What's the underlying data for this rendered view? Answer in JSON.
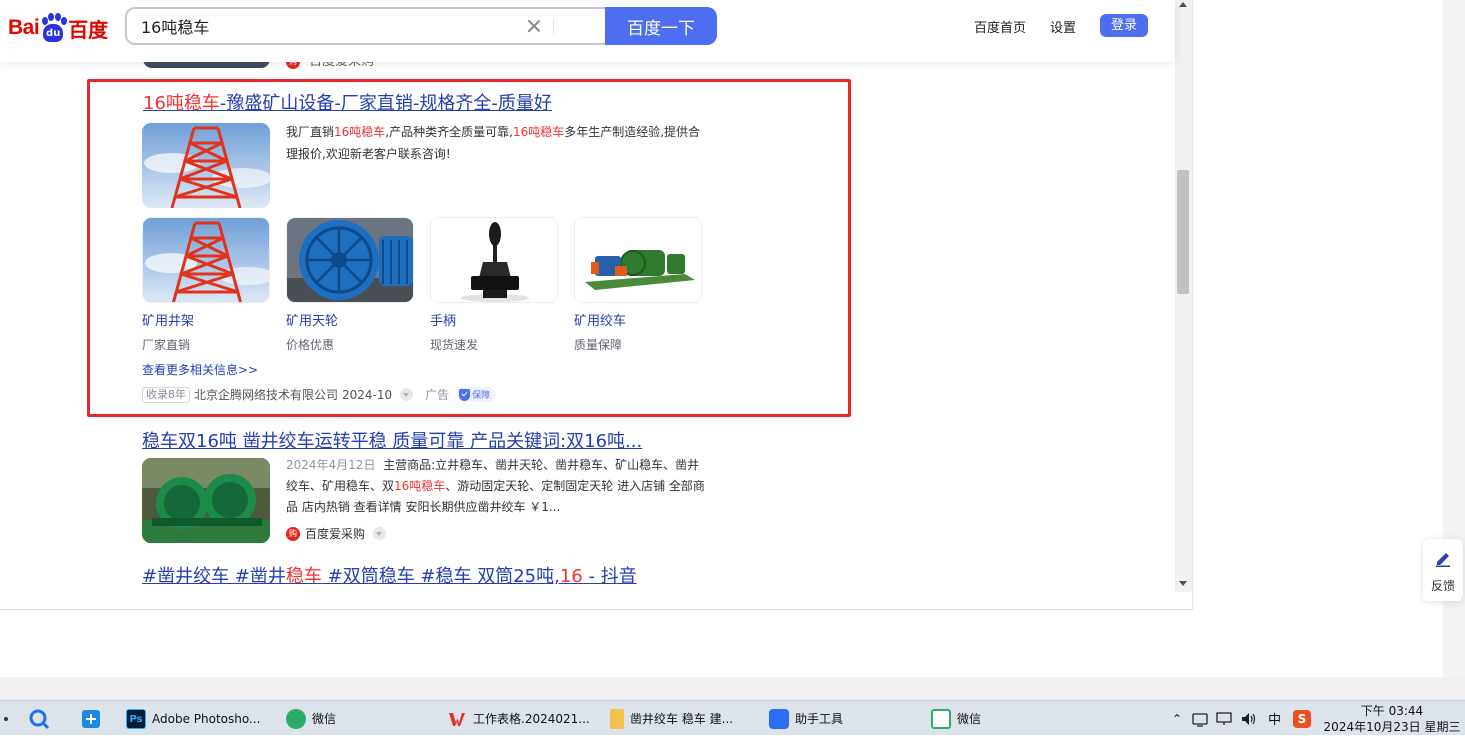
{
  "header": {
    "logo_text_en": "Bai",
    "logo_text_du": "du",
    "logo_text_cn": "百度",
    "search_value": "16吨稳车",
    "search_button": "百度一下",
    "link_home": "百度首页",
    "link_settings": "设置",
    "login_button": "登录"
  },
  "prev_result": {
    "source": "百度爱采购"
  },
  "ad_result": {
    "title_em": "16吨稳车",
    "title_rest": "-豫盛矿山设备-厂家直销-规格齐全-质量好",
    "desc_1": "我厂直销",
    "desc_em1": "16吨稳车",
    "desc_2": ",产品种类齐全质量可靠,",
    "desc_em2": "16吨稳车",
    "desc_3": "多年生产制造经验,提供合理报价,欢迎新老客户联系咨询!",
    "products": [
      {
        "name": "矿用井架",
        "sub": "厂家直销"
      },
      {
        "name": "矿用天轮",
        "sub": "价格优惠"
      },
      {
        "name": "手柄",
        "sub": "现货速发"
      },
      {
        "name": "矿用绞车",
        "sub": "质量保障"
      }
    ],
    "more_link": "查看更多相关信息>>",
    "badge_year": "收录8年",
    "company": "北京企腾网络技术有限公司",
    "date": "2024-10",
    "ad_label": "广告",
    "guarantee": "保障"
  },
  "result2": {
    "title": "稳车双16吨 凿井绞车运转平稳 质量可靠 产品关键词:双16吨...",
    "date": "2024年4月12日",
    "desc_1": "主营商品:立井稳车、凿井天轮、凿井稳车、矿山稳车、凿井绞车、矿用稳车、双",
    "desc_em": "16吨稳车",
    "desc_2": "、游动固定天轮、定制固定天轮 进入店铺 全部商品 店内热销 查看详情 安阳长期供应凿井绞车 ￥1...",
    "source": "百度爱采购",
    "source_icon": "购"
  },
  "result3": {
    "title_1": "#凿井绞车 #凿井",
    "title_em1": "稳车",
    "title_2": " #双筒稳车 #稳车 双筒25吨,",
    "title_em2": "16",
    "title_3": " - 抖音"
  },
  "feedback": {
    "label": "反馈"
  },
  "taskbar": {
    "photoshop": "Adobe Photosho...",
    "photoshop_icon": "Ps",
    "wechat_1": "微信",
    "wps": "工作表格.2024021...",
    "folder": "凿井绞车 稳车 建...",
    "helper": "助手工具",
    "wechat_2": "微信",
    "ime": "中",
    "clock_time": "下午 03:44",
    "clock_date": "2024年10月23日 星期三"
  },
  "colors": {
    "baidu_red": "#e10601",
    "baidu_blue": "#4e6ef2",
    "link_blue": "#2440b3",
    "highlight_red": "#f73131",
    "frame_red": "#ea2828"
  }
}
